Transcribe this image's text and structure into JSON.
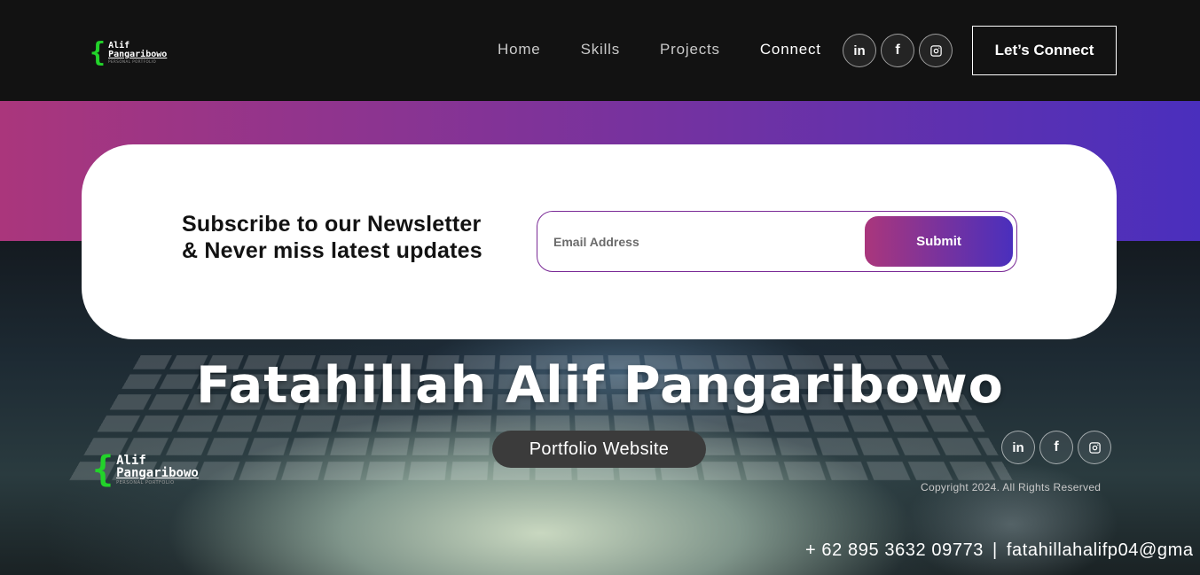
{
  "navbar": {
    "logo": {
      "first": "Alif",
      "last": "Pangaribowo",
      "sub": "PERSONAL PORTFOLIO"
    },
    "links": [
      {
        "label": "Home",
        "active": false
      },
      {
        "label": "Skills",
        "active": false
      },
      {
        "label": "Projects",
        "active": false
      },
      {
        "label": "Connect",
        "active": true
      }
    ],
    "social_icons": [
      "linkedin-icon",
      "facebook-icon",
      "instagram-icon"
    ],
    "social_labels": {
      "linkedin": "in",
      "facebook": "f"
    },
    "cta_label": "Let’s Connect"
  },
  "newsletter": {
    "heading_line1": "Subscribe to our Newsletter",
    "heading_line2": "& Never miss latest updates",
    "email_placeholder": "Email Address",
    "email_value": "",
    "submit_label": "Submit"
  },
  "hero": {
    "name": "Fatahillah Alif Pangaribowo",
    "subtitle": "Portfolio Website"
  },
  "footer": {
    "logo": {
      "first": "Alif",
      "last": "Pangaribowo",
      "sub": "PERSONAL PORTFOLIO"
    },
    "copyright": "Copyright 2024. All Rights Reserved",
    "phone": "+ 62 895 3632 09773",
    "separator": "|",
    "email": "fatahillahalifp04@gma"
  },
  "colors": {
    "accent_start": "#aa367c",
    "accent_end": "#4a2fbd",
    "logo_brace": "#22d32a",
    "background": "#121212"
  }
}
